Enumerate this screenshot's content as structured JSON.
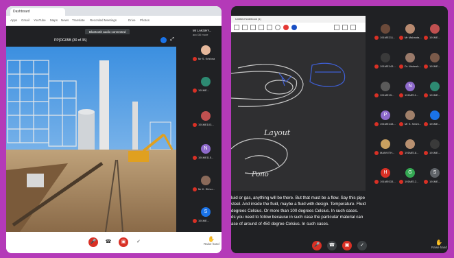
{
  "left": {
    "tab_title": "Dashboard",
    "bookmarks": [
      "Apps",
      "Gmail",
      "YouTube",
      "Maps",
      "News",
      "Translate",
      "Recorded Meetings",
      "Drive",
      "Photos"
    ],
    "notice": "Bluetooth audio connected",
    "presentation_title": "PP(DG05B (30 of 35)",
    "side_title": "Mr LAKSHY...",
    "side_subtitle": "and 30 more",
    "participants": [
      {
        "initial": "",
        "color": "#e6b89c",
        "name": "Mr S. Krishna"
      },
      {
        "initial": "",
        "color": "#2d8a72",
        "name": "191ME..."
      },
      {
        "initial": "",
        "color": "#c05050",
        "name": "191ME103..."
      },
      {
        "initial": "N",
        "color": "#8e6acb",
        "name": "191ME115..."
      },
      {
        "initial": "",
        "color": "#8a6a5a",
        "name": "Mr K. Shivu..."
      },
      {
        "initial": "S",
        "color": "#1a73e8",
        "name": "191ME..."
      }
    ],
    "raise_hand_label": "Raise hand"
  },
  "right": {
    "whiteboard_title": "Untitled Notebook (1)",
    "participants": [
      {
        "initial": "",
        "color": "#6b4a3a",
        "name": "191ME211..."
      },
      {
        "initial": "",
        "color": "#b88a70",
        "name": "Mr Mahanta..."
      },
      {
        "initial": "",
        "color": "#c05050",
        "name": "191ME..."
      },
      {
        "initial": "",
        "color": "#3a3a3a",
        "name": "191ME143..."
      },
      {
        "initial": "",
        "color": "#9a7a6a",
        "name": "Dr. Mahesh..."
      },
      {
        "initial": "",
        "color": "#7a5a4a",
        "name": "191ME..."
      },
      {
        "initial": "",
        "color": "#5a5a5a",
        "name": "191ME15..."
      },
      {
        "initial": "N",
        "color": "#8e6acb",
        "name": "191ME11..."
      },
      {
        "initial": "",
        "color": "#2d8a72",
        "name": "191ME..."
      },
      {
        "initial": "P",
        "color": "#8e6acb",
        "name": "191ME143..."
      },
      {
        "initial": "",
        "color": "#a0806a",
        "name": "Mr S. Seshi..."
      },
      {
        "initial": "",
        "color": "#1a73e8",
        "name": "191ME..."
      },
      {
        "initial": "",
        "color": "#c8a060",
        "name": "MANVITH..."
      },
      {
        "initial": "",
        "color": "#b89070",
        "name": "191ME18..."
      },
      {
        "initial": "",
        "color": "#3a3a3a",
        "name": "191ME..."
      },
      {
        "initial": "H",
        "color": "#d93025",
        "name": "191ME033..."
      },
      {
        "initial": "G",
        "color": "#34a853",
        "name": "191ME12..."
      },
      {
        "initial": "S",
        "color": "#5f6368",
        "name": "191ME..."
      }
    ],
    "caption_lines": [
      "luid or gas, anything will be there. But that must be a flow. Say this pipe",
      "steel. And inside the fluid, maybe a fluid with design. Temperature. Fluid",
      "degrees Celsius. Or more than 100 degrees Celsius. In such cases.",
      "ds you need to follow because in such case the particular material can",
      "ase of around of 450 degree Celsius. In such cases."
    ],
    "drawing_labels": {
      "layout": "Layout",
      "pipe": "Pono"
    },
    "raise_hand_label": "Raise hand"
  }
}
